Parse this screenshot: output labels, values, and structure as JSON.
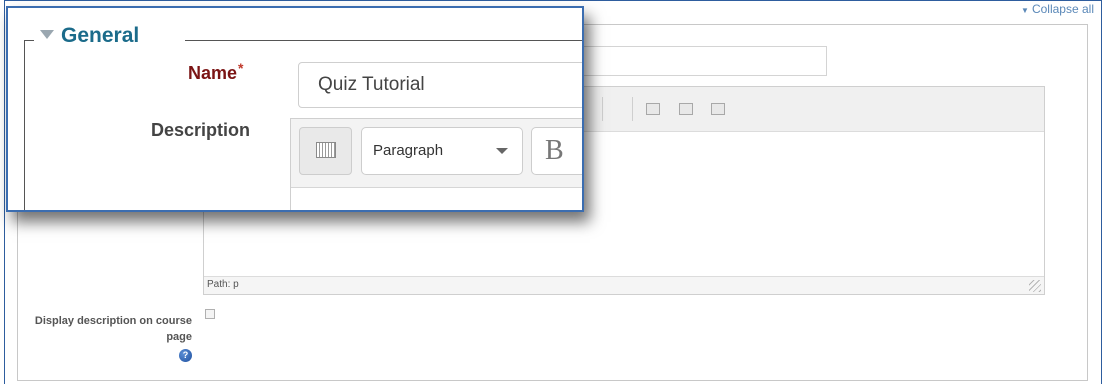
{
  "header": {
    "collapse_all_label": "Collapse all"
  },
  "form": {
    "section_title": "General",
    "name_label": "Name",
    "required_marker": "*",
    "name_value": "Quiz Tutorial",
    "description_label": "Description",
    "editor": {
      "format_select_value": "Paragraph",
      "bold_label": "B",
      "path_text": "Path: p"
    },
    "display_description_label": "Display description on course page",
    "help_label": "?"
  }
}
